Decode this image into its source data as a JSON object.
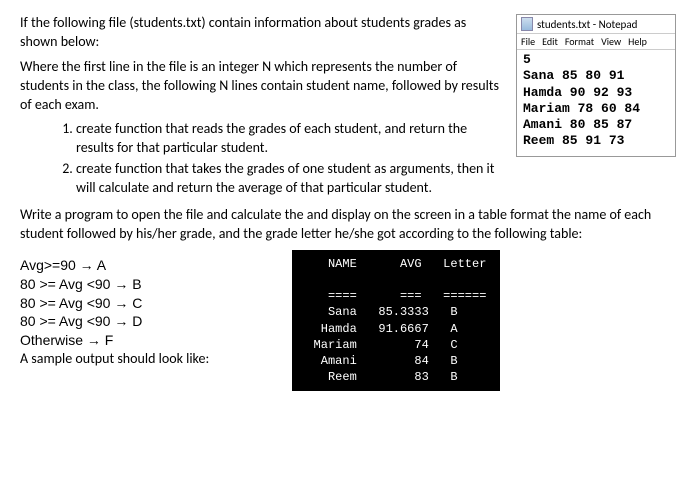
{
  "intro1": "If the following file (students.txt) contain information about students grades as shown below:",
  "intro2": "Where the first line in the file is an integer N which represents the number of students in the class, the following N lines contain student name, followed by results of each exam.",
  "tasks": {
    "t1": "create function that reads the grades of each student, and return the results for that particular student.",
    "t2": "create function that takes the grades of one student as arguments, then it will calculate and return the average of that particular student."
  },
  "writeprog": "Write a program to open the file and calculate the and display on the screen in a table format the name of each student followed by his/her grade, and the grade letter he/she got according to the following table:",
  "rules": {
    "r1": "Avg>=90 → A",
    "r2": "80 >= Avg <90 → B",
    "r3": "80 >= Avg <90 → C",
    "r4": "80 >= Avg <90 → D",
    "r5": "Otherwise → F"
  },
  "sample_label": "A sample output should look like:",
  "notepad": {
    "title": "students.txt - Notepad",
    "menu": {
      "m1": "File",
      "m2": "Edit",
      "m3": "Format",
      "m4": "View",
      "m5": "Help"
    },
    "content": "5\nSana 85 80 91\nHamda 90 92 93\nMariam 78 60 84\nAmani 80 85 87\nReem 85 91 73"
  },
  "output": "   NAME      AVG   Letter\n\n   ====      ===   ======\n   Sana   85.3333   B\n  Hamda   91.6667   A\n Mariam        74   C\n  Amani        84   B\n   Reem        83   B",
  "chart_data": {
    "type": "table",
    "title": "Sample Output",
    "columns": [
      "NAME",
      "AVG",
      "Letter"
    ],
    "rows": [
      [
        "Sana",
        85.3333,
        "B"
      ],
      [
        "Hamda",
        91.6667,
        "A"
      ],
      [
        "Mariam",
        74,
        "C"
      ],
      [
        "Amani",
        84,
        "B"
      ],
      [
        "Reem",
        83,
        "B"
      ]
    ]
  }
}
